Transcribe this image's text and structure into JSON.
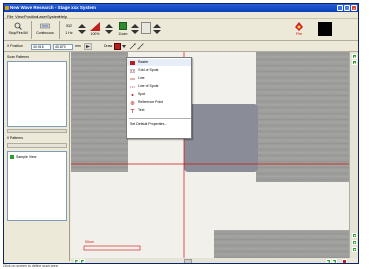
{
  "window": {
    "title": "New Wave Research - Stage xxx System",
    "min": "_",
    "max": "□",
    "close": "×"
  },
  "menu": [
    "File",
    "View",
    "Position",
    "Laser",
    "System",
    "Help"
  ],
  "toolbar": {
    "stop_label": "Stop/Fire/All",
    "continuous_label": "Continuous",
    "value1": "532",
    "value1_unit": "1 Hz",
    "value2": "100%",
    "zoom_label": "Zoom",
    "fire_label": "Fire"
  },
  "toolbar2": {
    "position_label": "X Position",
    "x_value": "40.915",
    "y_value": "40.870",
    "unit": "mm",
    "draw_label": "Draw"
  },
  "left_panel": {
    "scan_patterns_label": "Scan Patterns",
    "patterns_label": "0 Patterns",
    "sample_view_label": "Sample View"
  },
  "context_menu": [
    {
      "label": "Raster",
      "icon": "raster-icon"
    },
    {
      "label": "Grid of Spots",
      "icon": "grid-spots-icon"
    },
    {
      "label": "Line",
      "icon": "line-icon"
    },
    {
      "label": "Line of Spots",
      "icon": "line-spots-icon"
    },
    {
      "label": "Spot",
      "icon": "spot-icon"
    },
    {
      "label": "Reference Point",
      "icon": "reference-point-icon"
    },
    {
      "label": "Text",
      "icon": "text-icon"
    },
    {
      "label": "Set Default Properties...",
      "icon": ""
    }
  ],
  "view": {
    "scale_label": "50um"
  },
  "status": {
    "text": "Click on screen to define scan area"
  },
  "colors": {
    "crosshair": "#d01010",
    "accent_green": "#2f9e2f",
    "titlebar": "#0a3fb8"
  }
}
